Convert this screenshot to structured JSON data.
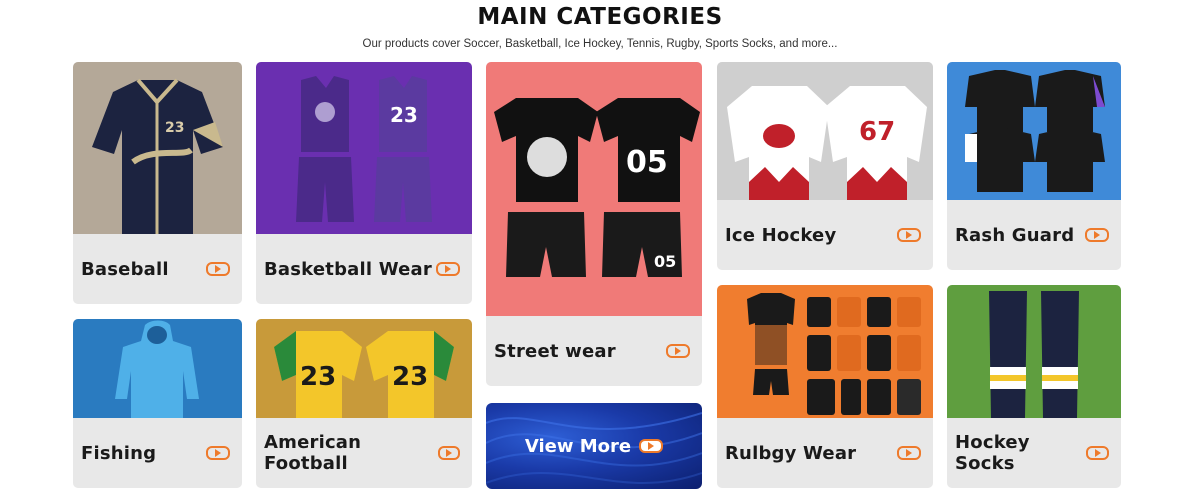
{
  "header": {
    "title": "MAIN CATEGORIES",
    "subtitle": "Our products cover Soccer, Basketball, Ice Hockey, Tennis, Rugby, Sports Socks, and more..."
  },
  "categories": [
    {
      "label": "Baseball"
    },
    {
      "label": "Basketball Wear"
    },
    {
      "label": "Street wear"
    },
    {
      "label": "Ice Hockey"
    },
    {
      "label": "Rash Guard"
    },
    {
      "label": "Fishing"
    },
    {
      "label": "American Football"
    },
    {
      "label": "Rulbgy Wear"
    },
    {
      "label": "Hockey Socks"
    }
  ],
  "view_more": {
    "label": "View More"
  },
  "colors": {
    "accent": "#ee7a2b",
    "label_bg": "#e8e8e8"
  }
}
